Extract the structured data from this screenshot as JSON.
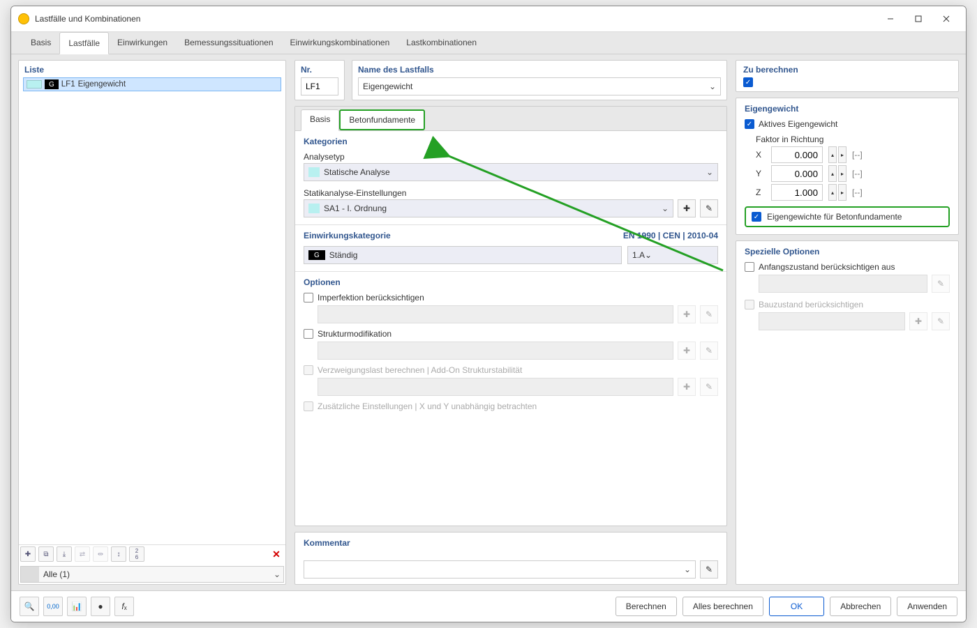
{
  "window": {
    "title": "Lastfälle und Kombinationen"
  },
  "tabs": [
    "Basis",
    "Lastfälle",
    "Einwirkungen",
    "Bemessungssituationen",
    "Einwirkungskombinationen",
    "Lastkombinationen"
  ],
  "active_tab": 1,
  "left": {
    "title": "Liste",
    "row": {
      "code": "G",
      "id": "LF1",
      "name": "Eigengewicht"
    },
    "filter": "Alle (1)"
  },
  "top": {
    "nr_label": "Nr.",
    "nr_value": "LF1",
    "name_label": "Name des Lastfalls",
    "name_value": "Eigengewicht",
    "calc_label": "Zu berechnen"
  },
  "subtabs": [
    "Basis",
    "Betonfundamente"
  ],
  "kategorien": {
    "title": "Kategorien",
    "analysetyp_label": "Analysetyp",
    "analysetyp_value": "Statische Analyse",
    "statik_label": "Statikanalyse-Einstellungen",
    "statik_value": "SA1 - I. Ordnung"
  },
  "einw": {
    "title": "Einwirkungskategorie",
    "standard": "EN 1990 | CEN | 2010-04",
    "cat_code": "G",
    "cat_name": "Ständig",
    "cat_sub": "1.A"
  },
  "optionen": {
    "title": "Optionen",
    "imperfektion": "Imperfektion berücksichtigen",
    "strukturmod": "Strukturmodifikation",
    "verzweigung": "Verzweigungslast berechnen | Add-On Strukturstabilität",
    "zusatz": "Zusätzliche Einstellungen | X und Y unabhängig betrachten"
  },
  "eigengewicht": {
    "title": "Eigengewicht",
    "aktiv": "Aktives Eigengewicht",
    "faktor_label": "Faktor in Richtung",
    "x": "0.000",
    "y": "0.000",
    "z": "1.000",
    "unit": "[--]",
    "fundamente": "Eigengewichte für Betonfundamente"
  },
  "spezielle": {
    "title": "Spezielle Optionen",
    "anfang": "Anfangszustand berücksichtigen aus",
    "bau": "Bauzustand berücksichtigen"
  },
  "kommentar": {
    "title": "Kommentar"
  },
  "footer": {
    "berechnen": "Berechnen",
    "alles": "Alles berechnen",
    "ok": "OK",
    "abbrechen": "Abbrechen",
    "anwenden": "Anwenden"
  }
}
